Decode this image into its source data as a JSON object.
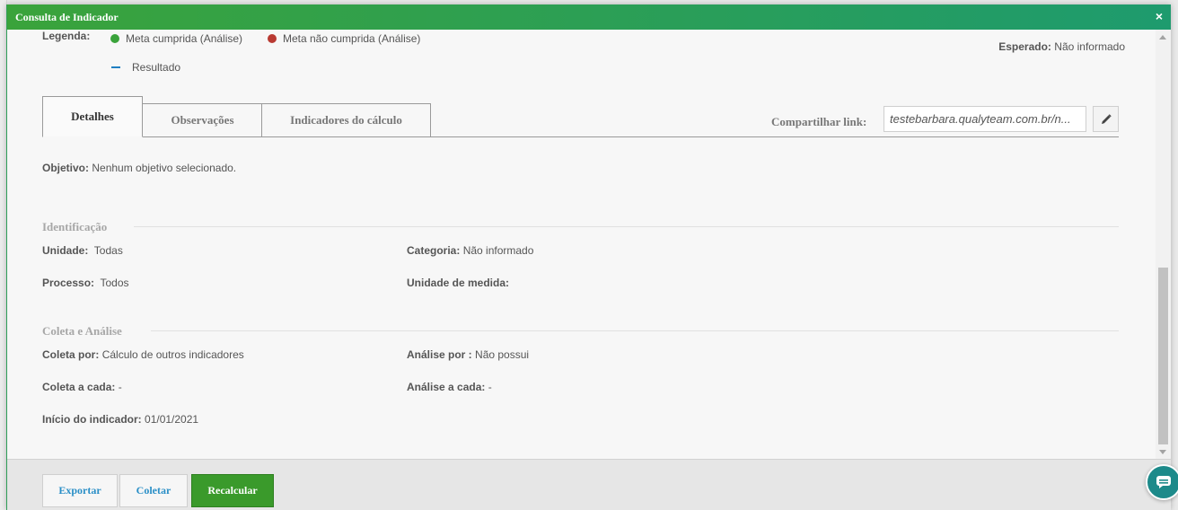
{
  "modal": {
    "title": "Consulta de Indicador",
    "close": "×"
  },
  "legend": {
    "label": "Legenda:",
    "items": [
      {
        "label": "Meta cumprida (Análise)",
        "color": "#3aa33b"
      },
      {
        "label": "Meta não cumprida (Análise)",
        "color": "#b93a32"
      },
      {
        "label": "Resultado",
        "color": "#1f7fc2"
      }
    ]
  },
  "expected": {
    "label": "Esperado:",
    "value": "Não informado"
  },
  "tabs": [
    {
      "label": "Detalhes",
      "active": true
    },
    {
      "label": "Observações",
      "active": false
    },
    {
      "label": "Indicadores do cálculo",
      "active": false
    }
  ],
  "share": {
    "label": "Compartilhar link:",
    "value": "testebarbara.qualyteam.com.br/n..."
  },
  "objective": {
    "label": "Objetivo:",
    "value": "Nenhum objetivo selecionado."
  },
  "identification": {
    "title": "Identificação",
    "unit_label": "Unidade:",
    "unit_value": "Todas",
    "category_label": "Categoria:",
    "category_value": "Não informado",
    "process_label": "Processo:",
    "process_value": "Todos",
    "measure_label": "Unidade de medida:",
    "measure_value": ""
  },
  "collection": {
    "title": "Coleta e Análise",
    "collect_by_label": "Coleta por:",
    "collect_by_value": "Cálculo de outros indicadores",
    "analysis_by_label": "Análise por :",
    "analysis_by_value": "Não possui",
    "collect_every_label": "Coleta a cada:",
    "collect_every_value": "-",
    "analysis_every_label": "Análise a cada:",
    "analysis_every_value": "-",
    "start_label": "Início do indicador:",
    "start_value": "01/01/2021"
  },
  "footer": {
    "export": "Exportar",
    "collect": "Coletar",
    "recalculate": "Recalcular"
  }
}
